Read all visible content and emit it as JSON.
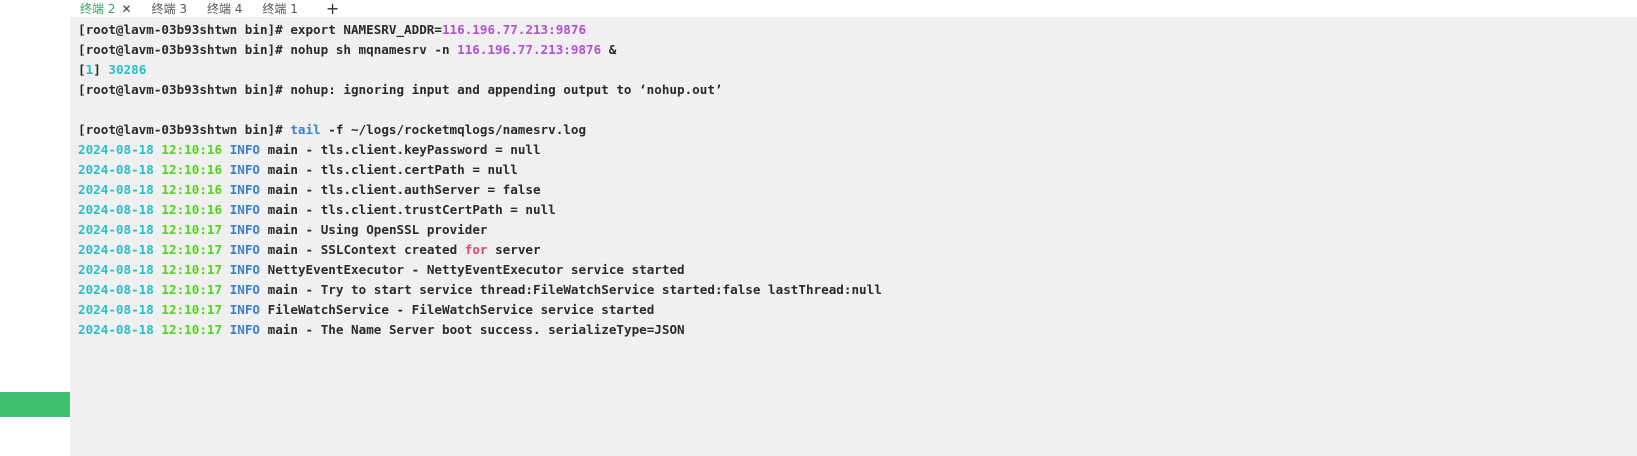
{
  "tabs": [
    {
      "label": "终端 2",
      "active": true,
      "closable": true
    },
    {
      "label": "终端 3",
      "active": false,
      "closable": false
    },
    {
      "label": "终端 4",
      "active": false,
      "closable": false
    },
    {
      "label": "终端 1",
      "active": false,
      "closable": false
    }
  ],
  "tab_close_glyph": "✕",
  "tab_add_glyph": "+",
  "prompt": "[root@lavm-03b93shtwn bin]# ",
  "commands": {
    "cmd1_text": "export NAMESRV_ADDR=",
    "cmd1_ip": "116.196.77.213:9876",
    "cmd2_text": "nohup sh mqnamesrv -n ",
    "cmd2_ip": "116.196.77.213:9876",
    "cmd2_tail": " &",
    "job_open": "[",
    "job_id": "1",
    "job_close": "] ",
    "job_pid": "30286",
    "nohup_msg": "nohup: ignoring input and appending output to ‘nohup.out’",
    "cmd3_tail": "tail",
    "cmd3_rest": " -f ~/logs/rocketmqlogs/namesrv.log"
  },
  "log_lines": [
    {
      "date": "2024-08-18",
      "time": "12:10:16",
      "level": "INFO",
      "msg": "main - tls.client.keyPassword = null"
    },
    {
      "date": "2024-08-18",
      "time": "12:10:16",
      "level": "INFO",
      "msg": "main - tls.client.certPath = null"
    },
    {
      "date": "2024-08-18",
      "time": "12:10:16",
      "level": "INFO",
      "msg": "main - tls.client.authServer = false"
    },
    {
      "date": "2024-08-18",
      "time": "12:10:16",
      "level": "INFO",
      "msg": "main - tls.client.trustCertPath = null"
    },
    {
      "date": "2024-08-18",
      "time": "12:10:17",
      "level": "INFO",
      "msg": "main - Using OpenSSL provider"
    },
    {
      "date": "2024-08-18",
      "time": "12:10:17",
      "level": "INFO",
      "msg_pre": "main - SSLContext created ",
      "msg_kw": "for",
      "msg_post": " server"
    },
    {
      "date": "2024-08-18",
      "time": "12:10:17",
      "level": "INFO",
      "msg": "NettyEventExecutor - NettyEventExecutor service started"
    },
    {
      "date": "2024-08-18",
      "time": "12:10:17",
      "level": "INFO",
      "msg": "main - Try to start service thread:FileWatchService started:false lastThread:null"
    },
    {
      "date": "2024-08-18",
      "time": "12:10:17",
      "level": "INFO",
      "msg": "FileWatchService - FileWatchService service started"
    },
    {
      "date": "2024-08-18",
      "time": "12:10:17",
      "level": "INFO",
      "msg": "main - The Name Server boot success. serializeType=JSON"
    }
  ],
  "colors": {
    "active_tab": "#2fa55a",
    "ip": "#b34fd6",
    "date": "#24c0c8",
    "time": "#4ed61c",
    "info": "#3a7fd1",
    "keyword": "#d8467a",
    "side_green": "#3dbf6e"
  }
}
